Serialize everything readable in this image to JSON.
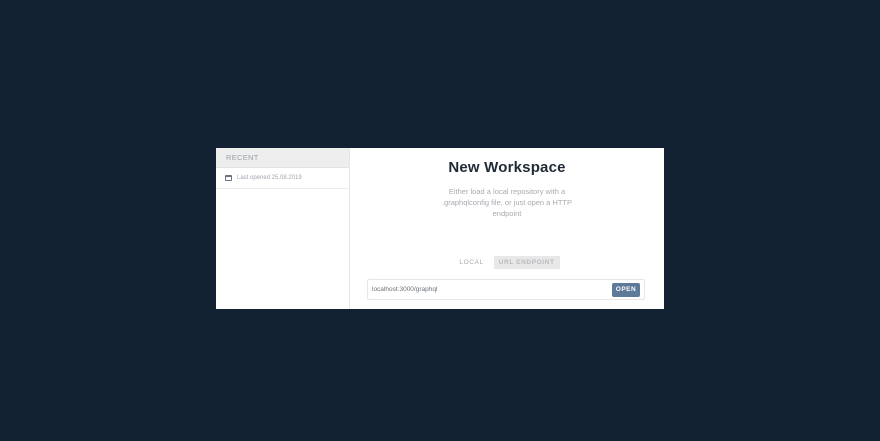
{
  "sidebar": {
    "header": "RECENT",
    "items": [
      {
        "icon": "folder-icon",
        "label": "Last opened 25.08.2019"
      }
    ]
  },
  "main": {
    "title": "New Workspace",
    "subtitle": "Either load a local repository with a .graphqlconfig file, or just open a HTTP endpoint",
    "tabs": [
      {
        "label": "LOCAL",
        "active": false
      },
      {
        "label": "URL ENDPOINT",
        "active": true
      }
    ],
    "url_input": {
      "value": "localhost:3000/graphql"
    },
    "open_label": "OPEN"
  },
  "colors": {
    "backdrop": "#122233",
    "open_button": "#5d7a98",
    "title": "#1f2a36"
  }
}
